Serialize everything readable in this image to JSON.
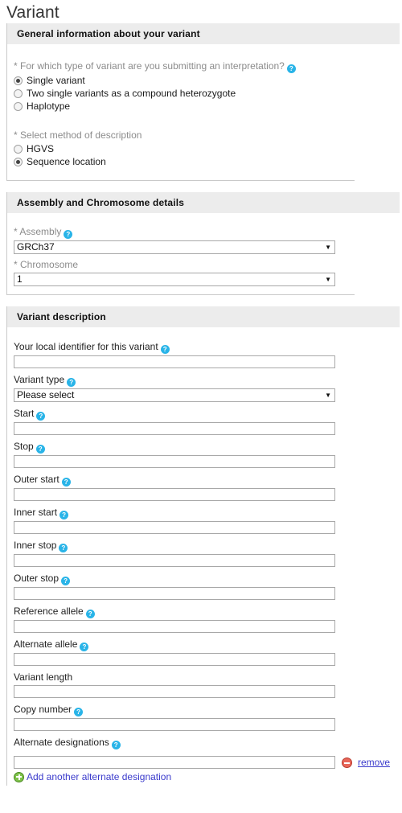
{
  "page": {
    "title": "Variant"
  },
  "colors": {
    "help_icon": "#29b4e8",
    "header_bg": "#ececec",
    "link": "#3b3bcc",
    "remove_icon": "#e8675a",
    "add_icon": "#7ec24a",
    "required_label": "#8c8c8c"
  },
  "help_glyph": "?",
  "select_arrow_glyph": "▼",
  "sections": {
    "general": {
      "header": "General information about your variant",
      "variant_type_question": {
        "label": "For which type of variant are you submitting an interpretation?",
        "required_marker": "*",
        "has_help": true,
        "options": [
          {
            "label": "Single variant",
            "checked": true
          },
          {
            "label": "Two single variants as a compound heterozygote",
            "checked": false
          },
          {
            "label": "Haplotype",
            "checked": false
          }
        ]
      },
      "method_question": {
        "label": "Select method of description",
        "required_marker": "*",
        "has_help": false,
        "options": [
          {
            "label": "HGVS",
            "checked": false
          },
          {
            "label": "Sequence location",
            "checked": true
          }
        ]
      }
    },
    "assembly": {
      "header": "Assembly and Chromosome details",
      "fields": [
        {
          "label": "Assembly",
          "required_marker": "*",
          "has_help": true,
          "type": "select",
          "value": "GRCh37"
        },
        {
          "label": "Chromosome",
          "required_marker": "*",
          "has_help": false,
          "type": "select",
          "value": "1"
        }
      ]
    },
    "variant_description": {
      "header": "Variant description",
      "fields": [
        {
          "label": "Your local identifier for this variant",
          "has_help": true,
          "type": "text",
          "value": ""
        },
        {
          "label": "Variant type",
          "has_help": true,
          "type": "select",
          "value": "Please select"
        },
        {
          "label": "Start",
          "has_help": true,
          "type": "text",
          "value": ""
        },
        {
          "label": "Stop",
          "has_help": true,
          "type": "text",
          "value": ""
        },
        {
          "label": "Outer start",
          "has_help": true,
          "type": "text",
          "value": ""
        },
        {
          "label": "Inner start",
          "has_help": true,
          "type": "text",
          "value": ""
        },
        {
          "label": "Inner stop",
          "has_help": true,
          "type": "text",
          "value": ""
        },
        {
          "label": "Outer stop",
          "has_help": true,
          "type": "text",
          "value": ""
        },
        {
          "label": "Reference allele",
          "has_help": true,
          "type": "text",
          "value": ""
        },
        {
          "label": "Alternate allele",
          "has_help": true,
          "type": "text",
          "value": ""
        },
        {
          "label": "Variant length",
          "has_help": false,
          "type": "text",
          "value": ""
        },
        {
          "label": "Copy number",
          "has_help": true,
          "type": "text",
          "value": ""
        }
      ],
      "alternate_designations": {
        "label": "Alternate designations",
        "has_help": true,
        "value": "",
        "remove_label": "remove",
        "add_label": "Add another alternate designation"
      }
    }
  }
}
